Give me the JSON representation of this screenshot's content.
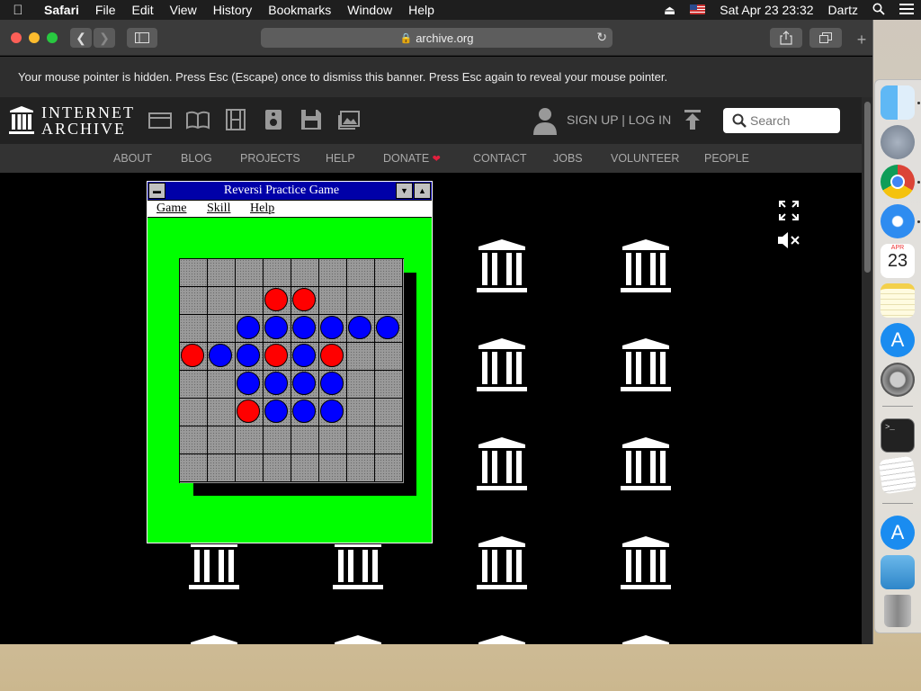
{
  "menubar": {
    "app_name": "Safari",
    "items": [
      "File",
      "Edit",
      "View",
      "History",
      "Bookmarks",
      "Window",
      "Help"
    ],
    "datetime": "Sat Apr 23  23:32",
    "user": "Dartz"
  },
  "browser": {
    "address": "archive.org",
    "lock_icon": "lock-icon",
    "banner_text": "Your mouse pointer is hidden. Press Esc (Escape) once to dismiss this banner. Press Esc again to reveal your mouse pointer."
  },
  "ia": {
    "logo_line1": "INTERNET",
    "logo_line2": "ARCHIVE",
    "signup": "SIGN UP | LOG IN",
    "search_placeholder": "Search",
    "nav": [
      "ABOUT",
      "BLOG",
      "PROJECTS",
      "HELP",
      "DONATE",
      "CONTACT",
      "JOBS",
      "VOLUNTEER",
      "PEOPLE"
    ],
    "donate_icon": "heart-icon"
  },
  "reversi": {
    "title": "Reversi Practice Game",
    "menu": [
      "Game",
      "Skill",
      "Help"
    ],
    "board": [
      "........",
      "...RR...",
      "..BBBBBB",
      "RBBRBR..",
      "..BBBB..",
      "..RBBB..",
      "........",
      "........"
    ]
  },
  "colors": {
    "reversi_bg": "#00ff00",
    "title_bar": "#0000a8",
    "red_disc": "#ff0000",
    "blue_disc": "#0000ff",
    "page_bg": "#000000"
  },
  "dock": [
    "Finder",
    "Launchpad",
    "Chrome",
    "Safari",
    "Calendar",
    "Notes",
    "App Store",
    "System Preferences",
    "Terminal",
    "TextEdit",
    "App Store Folder",
    "Downloads",
    "Trash"
  ],
  "calendar_icon": {
    "month": "APR",
    "day": "23"
  }
}
